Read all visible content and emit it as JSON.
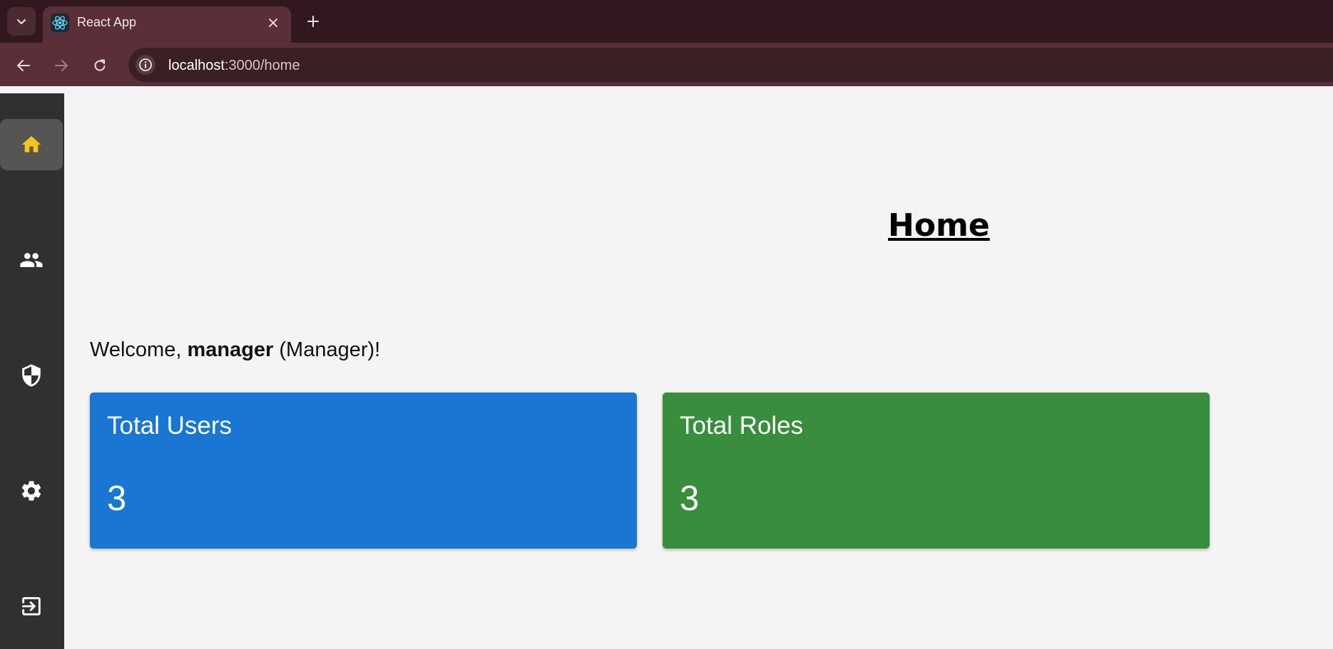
{
  "browser": {
    "tab_title": "React App",
    "url_host": "localhost",
    "url_path": ":3000/home",
    "icons": {
      "tab_menu": "chevron-down-icon",
      "favicon": "react-logo-icon",
      "close": "close-icon",
      "new_tab": "plus-icon",
      "back": "arrow-left-icon",
      "forward": "arrow-right-icon",
      "reload": "reload-icon",
      "site_info": "info-icon"
    }
  },
  "sidebar": {
    "items": [
      {
        "name": "home",
        "icon": "home-icon",
        "active": true
      },
      {
        "name": "users",
        "icon": "people-icon",
        "active": false
      },
      {
        "name": "roles",
        "icon": "shield-icon",
        "active": false
      },
      {
        "name": "settings",
        "icon": "gear-icon",
        "active": false
      },
      {
        "name": "logout",
        "icon": "logout-icon",
        "active": false
      }
    ],
    "active_icon_color": "#f5c518",
    "icon_color": "#ffffff"
  },
  "main": {
    "title": "Home",
    "welcome_prefix": "Welcome, ",
    "username": "manager",
    "role_suffix": " (Manager)!",
    "cards": [
      {
        "title": "Total Users",
        "value": "3",
        "color": "#1976d2"
      },
      {
        "title": "Total Roles",
        "value": "3",
        "color": "#388e3c"
      }
    ]
  }
}
